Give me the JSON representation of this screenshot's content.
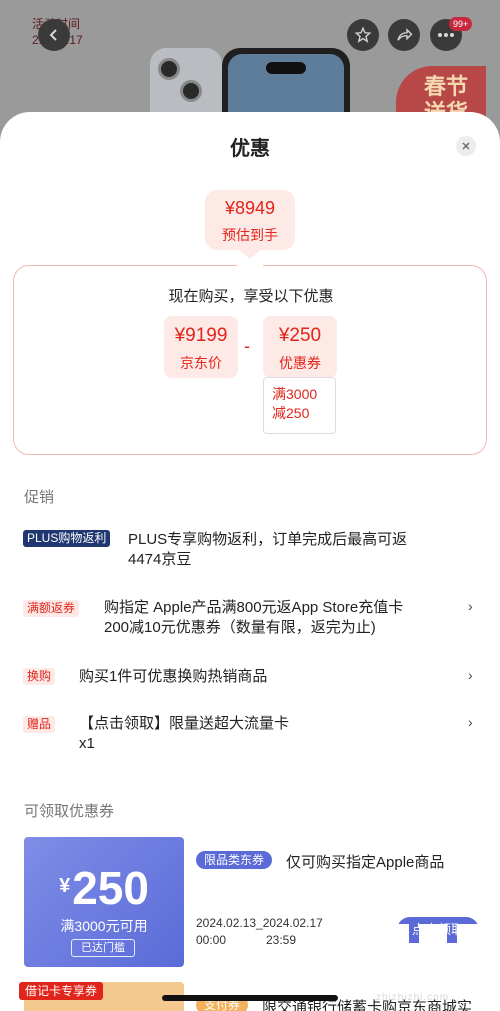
{
  "background": {
    "event_line1": "活动时间",
    "event_line2": "2.13-2.17",
    "promo_badge": "春节送货",
    "cart_count": "99+",
    "icons": [
      "back-icon",
      "star-icon",
      "share-icon",
      "more-icon"
    ]
  },
  "sheet": {
    "title": "优惠",
    "close_icon": "close-icon"
  },
  "estimate": {
    "price": "¥8949",
    "label": "预估到手"
  },
  "breakdown": {
    "title": "现在购买，享受以下优惠",
    "jd_price": "¥9199",
    "jd_label": "京东价",
    "minus": "-",
    "coupon_value": "¥250",
    "coupon_label": "优惠券",
    "coupon_condition_line1": "满3000",
    "coupon_condition_line2": "减250"
  },
  "promotions": {
    "section_title": "促销",
    "items": [
      {
        "tag": "PLUS购物返利",
        "text_line1": "PLUS专享购物返利，订单完成后最高可返",
        "text_line2": "4474京豆",
        "has_arrow": false
      },
      {
        "tag": "满额返券",
        "text_line1": "购指定 Apple产品满800元返App Store充值卡",
        "text_line2": "200减10元优惠券（数量有限，返完为止)",
        "has_arrow": true
      },
      {
        "tag": "换购",
        "text_line1": "购买1件可优惠换购热销商品",
        "text_line2": "",
        "has_arrow": true
      },
      {
        "tag": "赠品",
        "text_line1": "【点击领取】限量送超大流量卡",
        "text_line2": "x1",
        "has_arrow": true
      }
    ],
    "arrow": "›"
  },
  "coupons": {
    "section_title": "可领取优惠券",
    "first": {
      "currency": "¥",
      "amount": "250",
      "condition": "满3000元可用",
      "reached": "已达门槛",
      "tag": "限品类东券",
      "description": "仅可购买指定Apple商品",
      "date_range_line1": "2024.02.13_2024.02.17",
      "time_start": "00:00",
      "time_end": "23:59",
      "claim_button": "点击领取"
    },
    "second": {
      "corner_tag": "借记卡专享券",
      "tag": "支付券",
      "description": "限交通银行储蓄卡购京东商城实"
    }
  },
  "watermark": "zhizhizhi.com",
  "colors": {
    "accent_red": "#e1251b",
    "coupon_blue": "#5a6bd8",
    "plus_navy": "#1f3670"
  }
}
